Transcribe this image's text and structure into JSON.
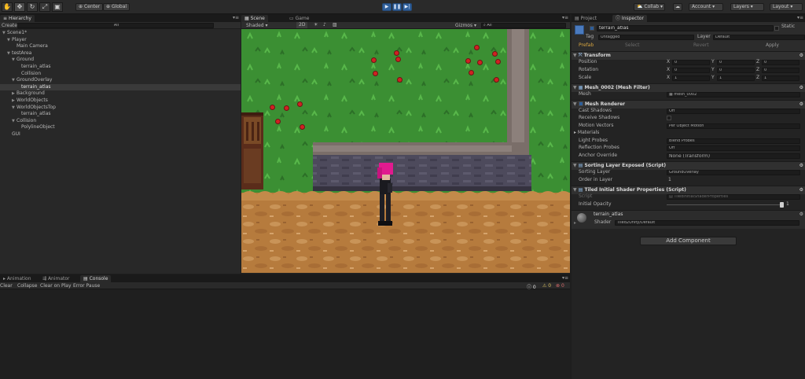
{
  "toolbar": {
    "center": "Center",
    "global": "Global",
    "collab": "Collab",
    "account": "Account",
    "layers": "Layers",
    "layout": "Layout"
  },
  "hierarchy": {
    "tab": "Hierarchy",
    "create": "Create",
    "search_placeholder": "All",
    "items": [
      {
        "label": "Scene1*",
        "indent": 0,
        "caret": "▼",
        "selected": false,
        "icon": "unity-scene-icon"
      },
      {
        "label": "Player",
        "indent": 1,
        "caret": "▼",
        "selected": false
      },
      {
        "label": "Main Camera",
        "indent": 2,
        "caret": "",
        "selected": false
      },
      {
        "label": "testArea",
        "indent": 1,
        "caret": "▼",
        "selected": false
      },
      {
        "label": "Ground",
        "indent": 2,
        "caret": "▼",
        "selected": false
      },
      {
        "label": "terrain_atlas",
        "indent": 3,
        "caret": "",
        "selected": false
      },
      {
        "label": "Collision",
        "indent": 3,
        "caret": "",
        "selected": false
      },
      {
        "label": "GroundOverlay",
        "indent": 2,
        "caret": "▼",
        "selected": false
      },
      {
        "label": "terrain_atlas",
        "indent": 3,
        "caret": "",
        "selected": true
      },
      {
        "label": "Background",
        "indent": 2,
        "caret": "▶",
        "selected": false
      },
      {
        "label": "WorldObjects",
        "indent": 2,
        "caret": "▶",
        "selected": false
      },
      {
        "label": "WorldObjectsTop",
        "indent": 2,
        "caret": "▼",
        "selected": false
      },
      {
        "label": "terrain_atlas",
        "indent": 3,
        "caret": "",
        "selected": false
      },
      {
        "label": "Collision",
        "indent": 2,
        "caret": "▼",
        "selected": false
      },
      {
        "label": "PolylineObject",
        "indent": 3,
        "caret": "",
        "selected": false
      },
      {
        "label": "GUI",
        "indent": 1,
        "caret": "",
        "selected": false
      }
    ]
  },
  "scene": {
    "tab_scene": "Scene",
    "tab_game": "Game",
    "shading": "Shaded",
    "mode2d": "2D",
    "gizmos": "Gizmos",
    "search_placeholder": "All"
  },
  "bottom": {
    "tabs": [
      "Animation",
      "Animator",
      "Console"
    ],
    "active": "Console",
    "buttons": [
      "Clear",
      "Collapse",
      "Clear on Play",
      "Error Pause"
    ],
    "counts": [
      "0",
      "0",
      "0"
    ]
  },
  "inspector": {
    "tab_project": "Project",
    "tab_inspector": "Inspector",
    "object_name": "terrain_atlas",
    "static_label": "Static",
    "tag_label": "Tag",
    "tag_value": "Untagged",
    "layer_label": "Layer",
    "layer_value": "Default",
    "prefab_label": "Prefab",
    "select": "Select",
    "revert": "Revert",
    "apply": "Apply",
    "transform": {
      "title": "Transform",
      "rows": [
        {
          "label": "Position",
          "x": "0",
          "y": "0",
          "z": "0"
        },
        {
          "label": "Rotation",
          "x": "0",
          "y": "0",
          "z": "0"
        },
        {
          "label": "Scale",
          "x": "1",
          "y": "1",
          "z": "1"
        }
      ]
    },
    "mesh_filter": {
      "title": "Mesh_0002 (Mesh Filter)",
      "mesh_label": "Mesh",
      "mesh_value": "mesh_0002"
    },
    "mesh_renderer": {
      "title": "Mesh Renderer",
      "cast_shadows": {
        "label": "Cast Shadows",
        "value": "Off"
      },
      "receive_shadows": {
        "label": "Receive Shadows"
      },
      "motion_vectors": {
        "label": "Motion Vectors",
        "value": "Per Object Motion"
      },
      "materials": "Materials",
      "light_probes": {
        "label": "Light Probes",
        "value": "Blend Probes"
      },
      "reflection_probes": {
        "label": "Reflection Probes",
        "value": "Off"
      },
      "anchor_override": {
        "label": "Anchor Override",
        "value": "None (Transform)"
      }
    },
    "sorting": {
      "title": "Sorting Layer Exposed (Script)",
      "layer_label": "Sorting Layer",
      "layer_value": "GroundOverlay",
      "order_label": "Order in Layer",
      "order_value": "1"
    },
    "tiled": {
      "title": "Tiled Initial Shader Properties (Script)",
      "script_label": "Script",
      "script_value": "TiledInitialShaderProperties",
      "opacity_label": "Initial Opacity",
      "opacity_value": "1"
    },
    "material": {
      "name": "terrain_atlas",
      "shader_label": "Shader",
      "shader_value": "Tiled2Unity/Default"
    },
    "add_component": "Add Component"
  }
}
